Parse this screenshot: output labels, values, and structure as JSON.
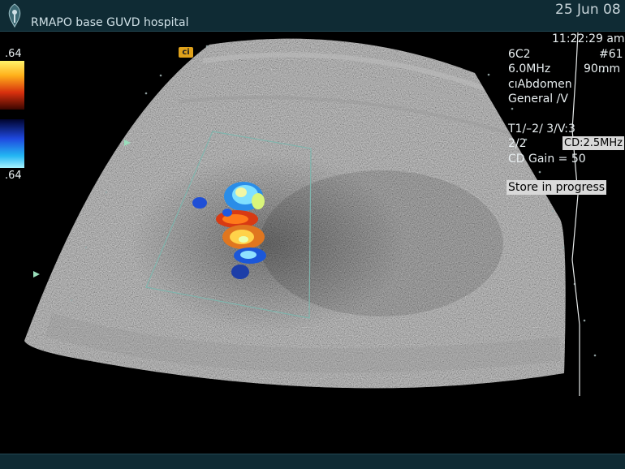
{
  "header": {
    "institution": "RMAPO base GUVD hospital",
    "date": "25 Jun 08",
    "logo_icon": "emblem-icon"
  },
  "side_panel": {
    "time": "11:22:29 am",
    "probe": "6C2",
    "image_number": "#61",
    "frequency": "6.0MHz",
    "depth": "90mm",
    "preset": "cıAbdomen",
    "mode": "General /V",
    "tissue_params": "T1/–2/ 3/V:3",
    "persist": "2/2",
    "cd_frequency": "CD:2.5MHz",
    "cd_gain": "CD Gain = 50",
    "status": "Store in progress"
  },
  "color_scale": {
    "top_value": ".64",
    "bottom_value": ".64"
  },
  "probe_marker": "ci"
}
